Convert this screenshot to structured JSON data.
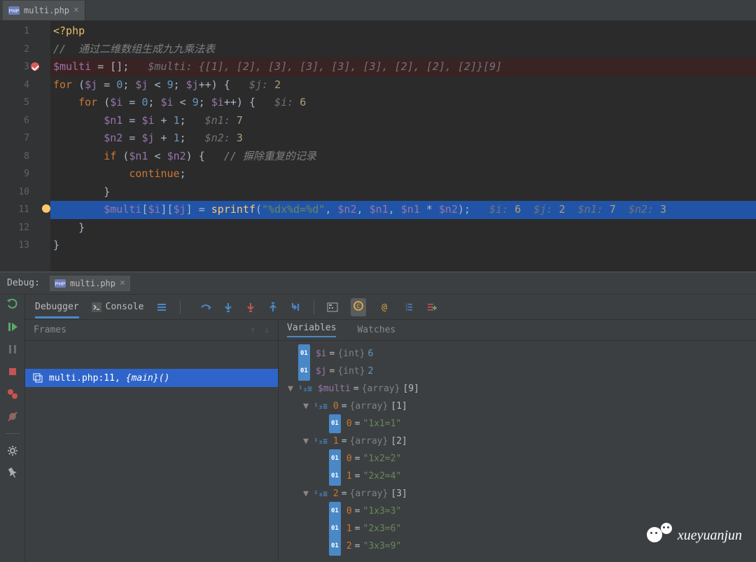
{
  "tab": {
    "name": "multi.php",
    "icon": "php-file-icon"
  },
  "code": {
    "lines": [
      {
        "n": 1,
        "segs": [
          [
            "tag",
            "<?php"
          ]
        ]
      },
      {
        "n": 2,
        "segs": [
          [
            "cmt",
            "//  通过二维数组生成九九乘法表"
          ]
        ]
      },
      {
        "n": 3,
        "bp": true,
        "segs": [
          [
            "var",
            "$multi"
          ],
          [
            "p",
            " = []"
          ],
          [
            "p",
            ";   "
          ],
          [
            "hint",
            "$multi: {[1], [2], [3], [3], [3], [3], [2], [2], [2]}[9]"
          ]
        ]
      },
      {
        "n": 4,
        "segs": [
          [
            "kw",
            "for "
          ],
          [
            "p",
            "("
          ],
          [
            "var",
            "$j"
          ],
          [
            "p",
            " = "
          ],
          [
            "num",
            "0"
          ],
          [
            "p",
            "; "
          ],
          [
            "var",
            "$j"
          ],
          [
            "p",
            " < "
          ],
          [
            "num",
            "9"
          ],
          [
            "p",
            "; "
          ],
          [
            "var",
            "$j"
          ],
          [
            "p",
            "++) {   "
          ],
          [
            "hint",
            "$j: "
          ],
          [
            "hnum",
            "2"
          ]
        ]
      },
      {
        "n": 5,
        "segs": [
          [
            "p",
            "    "
          ],
          [
            "kw",
            "for "
          ],
          [
            "p",
            "("
          ],
          [
            "var",
            "$i"
          ],
          [
            "p",
            " = "
          ],
          [
            "num",
            "0"
          ],
          [
            "p",
            "; "
          ],
          [
            "var",
            "$i"
          ],
          [
            "p",
            " < "
          ],
          [
            "num",
            "9"
          ],
          [
            "p",
            "; "
          ],
          [
            "var",
            "$i"
          ],
          [
            "p",
            "++) {   "
          ],
          [
            "hint",
            "$i: "
          ],
          [
            "hnum",
            "6"
          ]
        ]
      },
      {
        "n": 6,
        "segs": [
          [
            "p",
            "        "
          ],
          [
            "var",
            "$n1"
          ],
          [
            "p",
            " = "
          ],
          [
            "var",
            "$i"
          ],
          [
            "p",
            " + "
          ],
          [
            "num",
            "1"
          ],
          [
            "p",
            ";   "
          ],
          [
            "hint",
            "$n1: "
          ],
          [
            "hnum",
            "7"
          ]
        ]
      },
      {
        "n": 7,
        "segs": [
          [
            "p",
            "        "
          ],
          [
            "var",
            "$n2"
          ],
          [
            "p",
            " = "
          ],
          [
            "var",
            "$j"
          ],
          [
            "p",
            " + "
          ],
          [
            "num",
            "1"
          ],
          [
            "p",
            ";   "
          ],
          [
            "hint",
            "$n2: "
          ],
          [
            "hnum",
            "3"
          ]
        ]
      },
      {
        "n": 8,
        "segs": [
          [
            "p",
            "        "
          ],
          [
            "kw",
            "if "
          ],
          [
            "p",
            "("
          ],
          [
            "var",
            "$n1"
          ],
          [
            "p",
            " < "
          ],
          [
            "var",
            "$n2"
          ],
          [
            "p",
            ") {   "
          ],
          [
            "cmt",
            "// 摒除重复的记录"
          ]
        ]
      },
      {
        "n": 9,
        "segs": [
          [
            "p",
            "            "
          ],
          [
            "kw",
            "continue"
          ],
          [
            "p",
            ";"
          ]
        ]
      },
      {
        "n": 10,
        "segs": [
          [
            "p",
            "        }"
          ]
        ]
      },
      {
        "n": 11,
        "exec": true,
        "segs": [
          [
            "p",
            "        "
          ],
          [
            "var",
            "$multi"
          ],
          [
            "p",
            "["
          ],
          [
            "var",
            "$i"
          ],
          [
            "p",
            "]["
          ],
          [
            "var",
            "$j"
          ],
          [
            "p",
            "] = "
          ],
          [
            "fn",
            "sprintf"
          ],
          [
            "p",
            "("
          ],
          [
            "str",
            "\"%dx%d=%d\""
          ],
          [
            "p",
            ", "
          ],
          [
            "var",
            "$n2"
          ],
          [
            "p",
            ", "
          ],
          [
            "var",
            "$n1"
          ],
          [
            "p",
            ", "
          ],
          [
            "var",
            "$n1"
          ],
          [
            "p",
            " * "
          ],
          [
            "var",
            "$n2"
          ],
          [
            "p",
            ");   "
          ],
          [
            "hint",
            "$i: "
          ],
          [
            "hnum",
            "6"
          ],
          [
            "hint",
            "  $j: "
          ],
          [
            "hnum",
            "2"
          ],
          [
            "hint",
            "  $n1: "
          ],
          [
            "hnum",
            "7"
          ],
          [
            "hint",
            "  $n2: "
          ],
          [
            "hnum",
            "3"
          ]
        ]
      },
      {
        "n": 12,
        "segs": [
          [
            "p",
            "    }"
          ]
        ]
      },
      {
        "n": 13,
        "segs": [
          [
            "p",
            "}"
          ]
        ]
      }
    ]
  },
  "debug": {
    "label": "Debug:",
    "file": "multi.php",
    "tabs": {
      "debugger": "Debugger",
      "console": "Console"
    },
    "frames": {
      "title": "Frames",
      "row": {
        "file": "multi.php:11, ",
        "fn": "{main}()"
      }
    },
    "vars": {
      "tabs": {
        "variables": "Variables",
        "watches": "Watches"
      },
      "tree": [
        {
          "d": 0,
          "tw": "",
          "k": "01",
          "name": "$i",
          "eq": " = ",
          "type": "{int} ",
          "val": "6"
        },
        {
          "d": 0,
          "tw": "",
          "k": "01",
          "name": "$j",
          "eq": " = ",
          "type": "{int} ",
          "val": "2"
        },
        {
          "d": 0,
          "tw": "▼",
          "k": "13",
          "name": "$multi",
          "eq": " = ",
          "type": "{array} ",
          "arr": "[9]"
        },
        {
          "d": 1,
          "tw": "▼",
          "k": "13",
          "idx": "0",
          "eq": " = ",
          "type": "{array} ",
          "arr": "[1]"
        },
        {
          "d": 2,
          "tw": "",
          "k": "01",
          "idx": "0",
          "eq": " = ",
          "str": "\"1x1=1\""
        },
        {
          "d": 1,
          "tw": "▼",
          "k": "13",
          "idx": "1",
          "eq": " = ",
          "type": "{array} ",
          "arr": "[2]"
        },
        {
          "d": 2,
          "tw": "",
          "k": "01",
          "idx": "0",
          "eq": " = ",
          "str": "\"1x2=2\""
        },
        {
          "d": 2,
          "tw": "",
          "k": "01",
          "idx": "1",
          "eq": " = ",
          "str": "\"2x2=4\""
        },
        {
          "d": 1,
          "tw": "▼",
          "k": "13",
          "idx": "2",
          "eq": " = ",
          "type": "{array} ",
          "arr": "[3]"
        },
        {
          "d": 2,
          "tw": "",
          "k": "01",
          "idx": "0",
          "eq": " = ",
          "str": "\"1x3=3\""
        },
        {
          "d": 2,
          "tw": "",
          "k": "01",
          "idx": "1",
          "eq": " = ",
          "str": "\"2x3=6\""
        },
        {
          "d": 2,
          "tw": "",
          "k": "01",
          "idx": "2",
          "eq": " = ",
          "str": "\"3x3=9\""
        }
      ]
    }
  },
  "watermark": "xueyuanjun"
}
